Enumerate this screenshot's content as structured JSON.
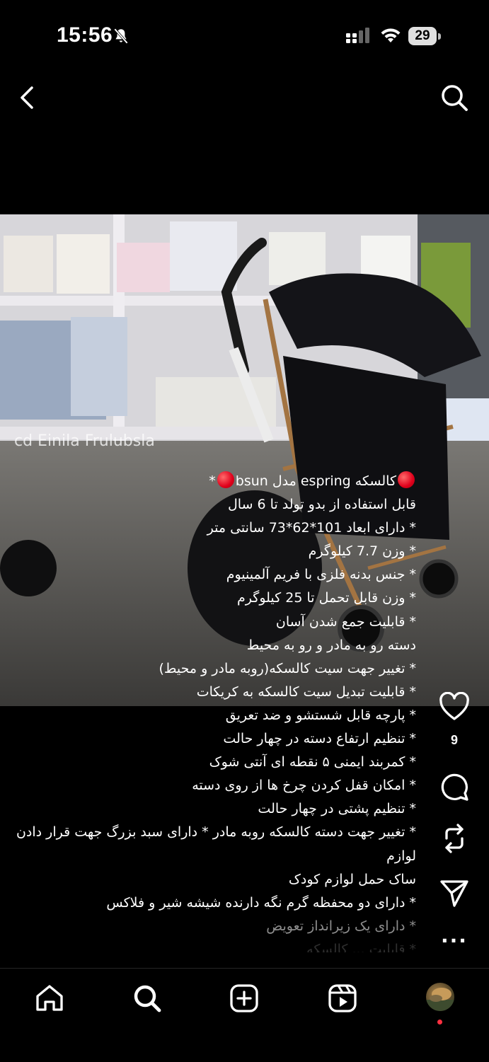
{
  "status_bar": {
    "time": "15:56",
    "battery": "29",
    "icons": [
      "bell-slash-icon",
      "cellular-signal-icon",
      "wifi-icon",
      "battery-icon"
    ]
  },
  "top_nav": {
    "back_icon": "chevron-left-icon",
    "search_icon": "search-icon"
  },
  "post": {
    "image_description_icon": "baby-stroller-photo",
    "overlay_text": "cd ‎Einila Frulubsla",
    "caption": {
      "title_line": {
        "prefix": "* ",
        "text": "کالسکه espring مدل bsun",
        "markers": "red-circle-emoji"
      },
      "lines": [
        "قابل استفاده از بدو تولد تا 6 سال",
        "* دارای ابعاد 101*62*73 سانتی متر",
        "* وزن 7.7 کیلوگرم",
        "* جنس بدنه فلزی با فریم آلمینیوم",
        "* وزن قابل تحمل تا 25 کیلوگرم",
        "* قابلیت جمع شدن آسان",
        "دسته رو به مادر و رو به محیط",
        "* تغییر جهت سیت کالسکه(روبه مادر و محیط)",
        "* قابلیت تبدیل سیت کالسکه به کریکات",
        "* پارچه قابل شستشو و ضد تعریق",
        "* تنظیم ارتفاع دسته در چهار حالت",
        "* کمربند ایمنی ۵ نقطه ای آنتی شوک",
        "* امکان قفل کردن چرخ ها از روی دسته",
        "* تنظیم پشتی در چهار حالت",
        "*  تغییر جهت دسته کالسکه روبه مادر * دارای سبد بزرگ جهت قرار دادن لوازم",
        "ساک حمل لوازم کودک",
        "* دارای دو محفظه گرم نگه دارنده شیشه شیر و فلاکس",
        "* دارای یک زیرانداز تعویض",
        "* قابلیت ... کالسکه"
      ]
    }
  },
  "actions": {
    "like_icon": "heart-icon",
    "like_count": "9",
    "comment_icon": "comment-icon",
    "repost_icon": "repost-icon",
    "share_icon": "send-icon",
    "more_icon": "more-icon",
    "more_label": "..."
  },
  "bottom_nav": {
    "items": [
      "home-icon",
      "search-icon",
      "create-icon",
      "reels-icon",
      "profile-avatar"
    ]
  }
}
